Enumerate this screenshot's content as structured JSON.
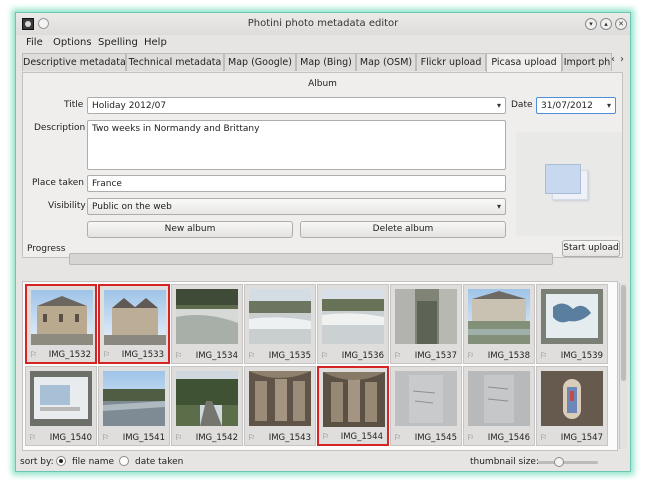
{
  "window": {
    "title": "Photini photo metadata editor"
  },
  "menu": [
    "File",
    "Options",
    "Spelling",
    "Help"
  ],
  "tabs": [
    "Descriptive metadata",
    "Technical metadata",
    "Map (Google)",
    "Map (Bing)",
    "Map (OSM)",
    "Flickr upload",
    "Picasa upload",
    "Import ph"
  ],
  "album": {
    "header": "Album",
    "title_label": "Title",
    "title_value": "Holiday 2012/07",
    "date_label": "Date",
    "date_value": "31/07/2012",
    "description_label": "Description",
    "description_value": "Two weeks in Normandy and Brittany",
    "place_label": "Place taken",
    "place_value": "France",
    "visibility_label": "Visibility",
    "visibility_value": "Public on the web",
    "new_album": "New album",
    "delete_album": "Delete album"
  },
  "progress": {
    "label": "Progress",
    "value": 0,
    "start_upload": "Start upload"
  },
  "thumbnails": [
    {
      "name": "IMG_1532",
      "selected": true
    },
    {
      "name": "IMG_1533",
      "selected": true
    },
    {
      "name": "IMG_1534",
      "selected": false
    },
    {
      "name": "IMG_1535",
      "selected": false
    },
    {
      "name": "IMG_1536",
      "selected": false
    },
    {
      "name": "IMG_1537",
      "selected": false
    },
    {
      "name": "IMG_1538",
      "selected": false
    },
    {
      "name": "IMG_1539",
      "selected": false
    },
    {
      "name": "IMG_1540",
      "selected": false
    },
    {
      "name": "IMG_1541",
      "selected": false
    },
    {
      "name": "IMG_1542",
      "selected": false
    },
    {
      "name": "IMG_1543",
      "selected": false
    },
    {
      "name": "IMG_1544",
      "selected": true
    },
    {
      "name": "IMG_1545",
      "selected": false
    },
    {
      "name": "IMG_1546",
      "selected": false
    },
    {
      "name": "IMG_1547",
      "selected": false
    }
  ],
  "bottom": {
    "sort_label": "sort by:",
    "sort_file_name": "file name",
    "sort_date_taken": "date taken",
    "thumb_size_label": "thumbnail size:"
  },
  "colors": {
    "selection": "#d62424",
    "window_glow": "#8fe3c9"
  }
}
